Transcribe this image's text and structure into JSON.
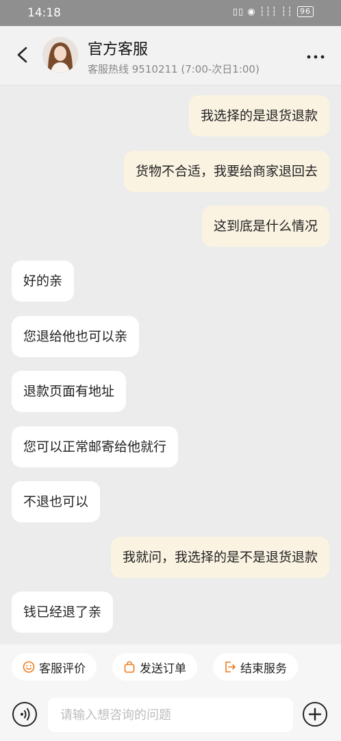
{
  "status_bar": {
    "time": "14:18",
    "icons": "▯▯ ◉ ┆┆┆ ┆┆",
    "battery": "96"
  },
  "header": {
    "title": "官方客服",
    "subtitle": "客服热线 9510211 (7:00-次日1:00)"
  },
  "messages": [
    {
      "from": "me",
      "text": "我选择的是退货退款"
    },
    {
      "from": "me",
      "text": "货物不合适，我要给商家退回去"
    },
    {
      "from": "me",
      "text": "这到底是什么情况"
    },
    {
      "from": "agent",
      "text": "好的亲"
    },
    {
      "from": "agent",
      "text": "您退给他也可以亲"
    },
    {
      "from": "agent",
      "text": "退款页面有地址"
    },
    {
      "from": "agent",
      "text": "您可以正常邮寄给他就行"
    },
    {
      "from": "agent",
      "text": "不退也可以"
    },
    {
      "from": "me",
      "text": "我就问，我选择的是不是退货退款"
    },
    {
      "from": "agent",
      "text": "钱已经退了亲"
    }
  ],
  "quick_actions": [
    {
      "label": "客服评价",
      "icon": "smile-icon"
    },
    {
      "label": "发送订单",
      "icon": "bag-icon"
    },
    {
      "label": "结束服务",
      "icon": "exit-icon"
    }
  ],
  "input": {
    "placeholder": "请输入想咨询的问题",
    "value": ""
  },
  "colors": {
    "accent": "#f07a1a",
    "my_bubble": "#fbf3e2",
    "agent_bubble": "#ffffff",
    "background": "#ececec"
  }
}
